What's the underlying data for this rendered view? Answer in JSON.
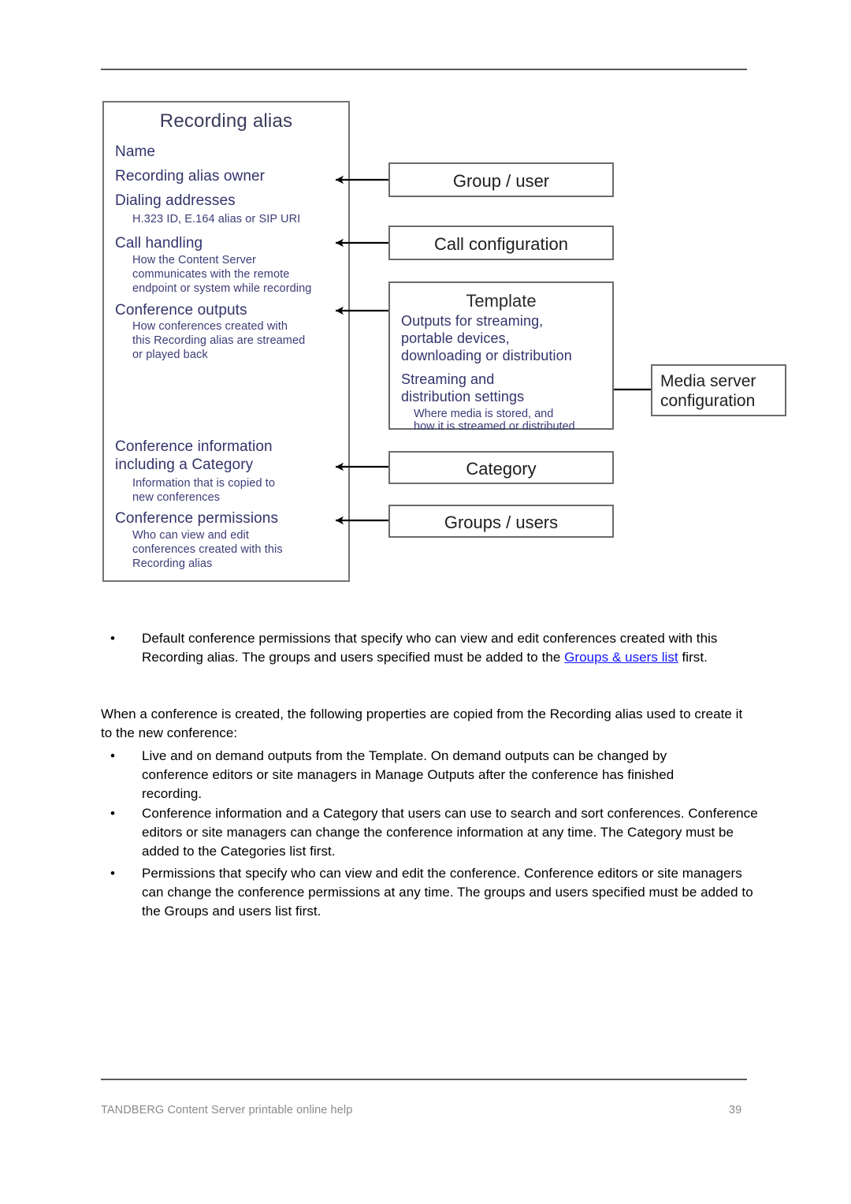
{
  "page": {
    "footer_left": "TANDBERG Content Server printable online help",
    "footer_right": "39"
  },
  "diagram": {
    "main": {
      "title": "Recording alias",
      "items": [
        {
          "heading": "Name",
          "sub": ""
        },
        {
          "heading": "Recording alias owner",
          "sub": ""
        },
        {
          "heading": "Dialing addresses",
          "sub": "H.323 ID, E.164 alias or SIP URI"
        },
        {
          "heading": "Call handling",
          "sub": "How the Content Server communicates with the remote endpoint or system while recording"
        },
        {
          "heading": "Conference outputs",
          "sub": "How conferences created with this Recording alias are streamed or played back"
        },
        {
          "heading": "Conference information including a Category",
          "sub": "Information that is copied to new conferences"
        },
        {
          "heading": "Conference permissions",
          "sub": "Who can view and edit conferences created with this Recording alias"
        }
      ],
      "sub_lines": {
        "dialing": [
          "H.323 ID, E.164 alias or SIP URI"
        ],
        "call_handling": [
          "How the Content Server",
          "communicates with the remote",
          "endpoint or system while recording"
        ],
        "conference_outputs": [
          "How conferences created with",
          "this Recording alias are streamed",
          "or played back"
        ],
        "conference_information": [
          "Information that is copied to",
          "new conferences"
        ],
        "conference_permissions": [
          "Who can view and edit",
          "conferences created with this",
          "Recording alias"
        ]
      },
      "heading_lines": {
        "conference_information_l1": "Conference information",
        "conference_information_l2": "including a Category"
      }
    },
    "boxes": {
      "group_user": "Group / user",
      "call_configuration": "Call configuration",
      "category": "Category",
      "groups_users": "Groups / users",
      "media_server_l1": "Media server",
      "media_server_l2": "configuration"
    },
    "template": {
      "title": "Template",
      "outputs_l1": "Outputs for streaming,",
      "outputs_l2": "portable devices,",
      "outputs_l3": "downloading or distribution",
      "settings_l1": "Streaming and",
      "settings_l2": "distribution settings",
      "settings_sub_l1": "Where media is stored, and",
      "settings_sub_l2": "how it is streamed or distributed"
    }
  },
  "body": {
    "bullet_glyph": "•",
    "bullet_1": {
      "text_before_link": "Default conference permissions that specify who can view and edit conferences created with this Recording alias. The groups and users specified must be added to the ",
      "link_text": "Groups & users list",
      "text_after_link": " first."
    },
    "intro_paragraph": "When a conference is created, the following properties are copied from the Recording alias used to create it to the new conference:",
    "bullet_2": "Live and on demand outputs from the Template. On demand outputs can be changed by conference editors or site managers in Manage Outputs after the conference has finished recording.",
    "bullet_3": "Conference information and a Category that users can use to search and sort conferences. Conference editors or site managers can change the conference information at any time. The Category must be added to the Categories list first.",
    "bullet_4": "Permissions that specify who can view and edit the conference. Conference editors or site managers can change the conference permissions at any time. The groups and users specified must be added to the Groups and users list first."
  },
  "colors": {
    "diagram_text_blue": "#33336b",
    "link_blue": "#1414ff",
    "rule_gray": "#595959",
    "footer_gray": "#8a8a8a"
  }
}
